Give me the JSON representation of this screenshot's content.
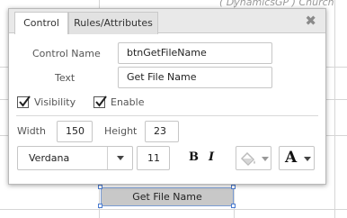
{
  "background": {
    "text": "( DynamicsGP ) Church",
    "button_label": "Get File Name"
  },
  "panel": {
    "tabs": [
      {
        "label": "Control",
        "active": true
      },
      {
        "label": "Rules/Attributes",
        "active": false
      }
    ],
    "close_icon": "close-icon",
    "control_name_label": "Control Name",
    "control_name_value": "btnGetFileName",
    "text_label": "Text",
    "text_value": "Get File Name",
    "visibility_label": "Visibility",
    "visibility_checked": true,
    "enable_label": "Enable",
    "enable_checked": true,
    "width_label": "Width",
    "width_value": "150",
    "height_label": "Height",
    "height_value": "23",
    "font_family": "Verdana",
    "font_size": "11",
    "bold_label": "B",
    "italic_label": "I",
    "fill_color_icon": "paint-bucket-icon",
    "font_color_label": "A"
  },
  "colors": {
    "selection_border": "#4a7bd0",
    "button_bg": "#c8c8c8"
  }
}
